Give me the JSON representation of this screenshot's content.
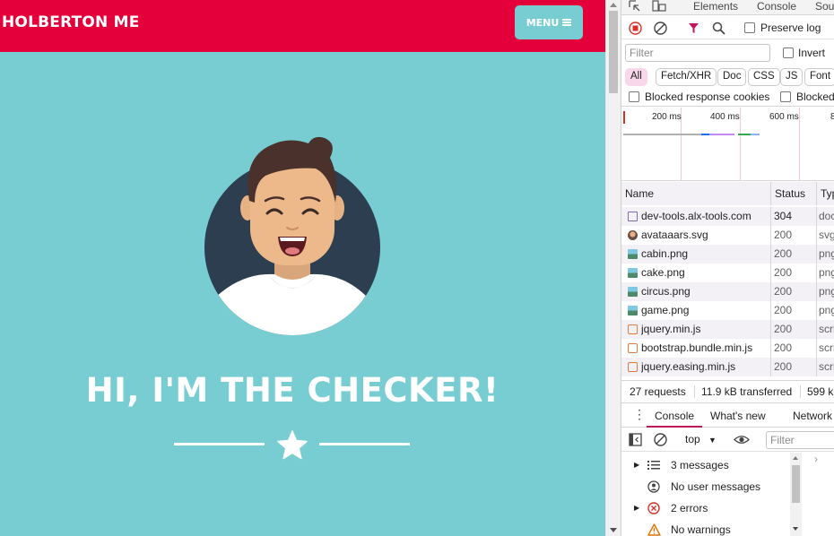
{
  "page": {
    "brand": "HOLBERTON ME",
    "menu_label": "MENU",
    "hero_title": "HI, I'M THE CHECKER!"
  },
  "devtools": {
    "tabs": [
      "Elements",
      "Console",
      "Sou"
    ],
    "preserve_log_label": "Preserve log",
    "filter_placeholder": "Filter",
    "invert_label": "Invert",
    "type_filters": [
      "All",
      "Fetch/XHR",
      "Doc",
      "CSS",
      "JS",
      "Font"
    ],
    "blocked_cookies_label": "Blocked response cookies",
    "blocked_requests_label": "Blocked",
    "timeline_ticks": [
      "200 ms",
      "400 ms",
      "600 ms",
      "8"
    ],
    "columns": [
      "Name",
      "Status",
      "Typ"
    ],
    "requests": [
      {
        "name": "dev-tools.alx-tools.com",
        "status": "304",
        "type": "doc",
        "icon": "document-icon"
      },
      {
        "name": "avataaars.svg",
        "status": "200",
        "type": "svg",
        "icon": "avatar-thumbnail-icon"
      },
      {
        "name": "cabin.png",
        "status": "200",
        "type": "png",
        "icon": "image-icon"
      },
      {
        "name": "cake.png",
        "status": "200",
        "type": "png",
        "icon": "image-icon"
      },
      {
        "name": "circus.png",
        "status": "200",
        "type": "png",
        "icon": "image-icon"
      },
      {
        "name": "game.png",
        "status": "200",
        "type": "png",
        "icon": "image-icon"
      },
      {
        "name": "jquery.min.js",
        "status": "200",
        "type": "scri",
        "icon": "script-icon"
      },
      {
        "name": "bootstrap.bundle.min.js",
        "status": "200",
        "type": "scri",
        "icon": "script-icon"
      },
      {
        "name": "jquery.easing.min.js",
        "status": "200",
        "type": "scri",
        "icon": "script-icon"
      }
    ],
    "summary": {
      "requests": "27 requests",
      "transferred": "11.9 kB transferred",
      "resources": "599 k"
    },
    "console_tabs": [
      "Console",
      "What's new",
      "Network"
    ],
    "console_context": "top",
    "console_filter_placeholder": "Filter",
    "console_messages": [
      {
        "label": "3 messages",
        "icon": "list-icon"
      },
      {
        "label": "No user messages",
        "icon": "user-icon"
      },
      {
        "label": "2 errors",
        "icon": "error-icon"
      },
      {
        "label": "No warnings",
        "icon": "warning-icon"
      }
    ]
  },
  "colors": {
    "navbar": "#e4003a",
    "page_background": "#78cdd2",
    "avatar_circle": "#2c3e50",
    "type_filter_active": "#f9d7ea"
  }
}
